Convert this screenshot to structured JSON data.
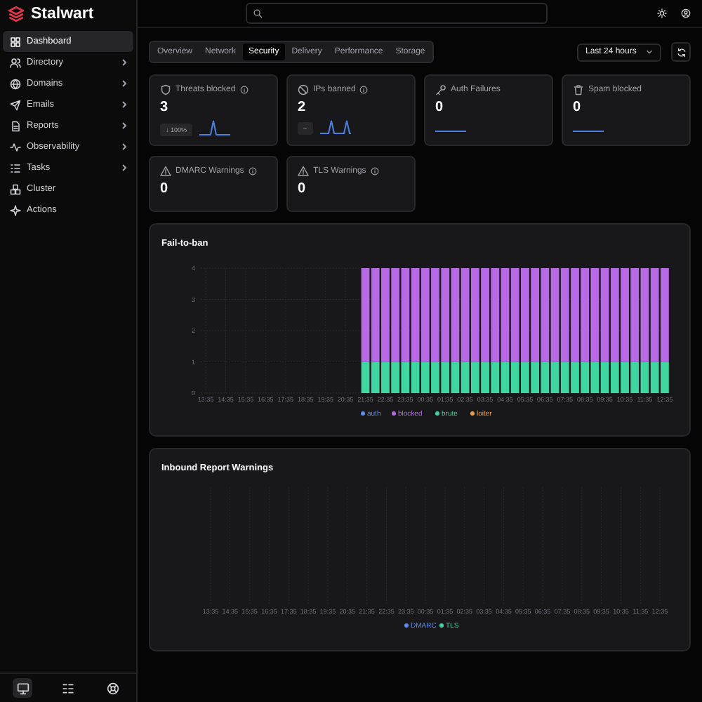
{
  "header": {
    "logo": "Stalwart"
  },
  "sidebar": {
    "items": [
      {
        "label": "Dashboard",
        "selected": true,
        "expandable": false
      },
      {
        "label": "Directory",
        "selected": false,
        "expandable": true
      },
      {
        "label": "Domains",
        "selected": false,
        "expandable": true
      },
      {
        "label": "Emails",
        "selected": false,
        "expandable": true
      },
      {
        "label": "Reports",
        "selected": false,
        "expandable": true
      },
      {
        "label": "Observability",
        "selected": false,
        "expandable": true
      },
      {
        "label": "Tasks",
        "selected": false,
        "expandable": true
      },
      {
        "label": "Cluster",
        "selected": false,
        "expandable": false
      },
      {
        "label": "Actions",
        "selected": false,
        "expandable": false
      }
    ],
    "footer_buttons": [
      {
        "selected": true
      },
      {
        "selected": false
      },
      {
        "selected": false
      }
    ]
  },
  "tabs": [
    {
      "label": "Overview",
      "selected": false
    },
    {
      "label": "Network",
      "selected": false
    },
    {
      "label": "Security",
      "selected": true
    },
    {
      "label": "Delivery",
      "selected": false
    },
    {
      "label": "Performance",
      "selected": false
    },
    {
      "label": "Storage",
      "selected": false
    }
  ],
  "time_range": {
    "value": "Last 24 hours"
  },
  "stats": [
    {
      "kind": "spike",
      "title": "Threats blocked",
      "info": true,
      "value": "3",
      "badge": "↓ 100%"
    },
    {
      "kind": "double-spike",
      "title": "IPs banned",
      "info": true,
      "value": "2",
      "badge": "–"
    },
    {
      "kind": "flat",
      "title": "Auth Failures",
      "info": false,
      "value": "0"
    },
    {
      "kind": "flat",
      "title": "Spam blocked",
      "info": false,
      "value": "0"
    },
    {
      "kind": "plain",
      "title": "DMARC Warnings",
      "info": true,
      "value": "0"
    },
    {
      "kind": "plain",
      "title": "TLS Warnings",
      "info": true,
      "value": "0"
    }
  ],
  "charts": [
    {
      "title": "Fail-to-ban",
      "chart_data": {
        "type": "bar",
        "stacked": true,
        "grid": true,
        "legend": true,
        "categories": [
          "13:35",
          null,
          "14:35",
          null,
          "15:35",
          null,
          "16:35",
          null,
          "17:35",
          null,
          "18:35",
          null,
          "19:35",
          null,
          "20:35",
          null,
          "21:35",
          null,
          "22:35",
          null,
          "23:35",
          null,
          "00:35",
          null,
          "01:35",
          null,
          "02:35",
          null,
          "03:35",
          null,
          "04:35",
          null,
          "05:35",
          null,
          "06:35",
          null,
          "07:35",
          null,
          "08:35",
          null,
          "09:35",
          null,
          "10:35",
          null,
          "11:35",
          null,
          "12:35"
        ],
        "ylim": [
          0,
          4
        ],
        "yticks": [
          0,
          1,
          2,
          3,
          4
        ],
        "series": [
          {
            "name": "auth",
            "color": "#5b8def",
            "values": [
              null,
              null,
              null,
              null,
              null,
              null,
              null,
              null,
              null,
              null,
              null,
              null,
              null,
              null,
              null,
              null,
              null,
              null,
              null,
              null,
              null,
              null,
              null,
              null,
              null,
              null,
              null,
              null,
              null,
              null,
              null,
              null,
              null,
              null,
              null,
              null,
              null,
              null,
              null,
              null,
              null,
              null,
              null,
              null,
              null,
              null,
              null
            ]
          },
          {
            "name": "blocked",
            "color": "#b86ae6",
            "values": [
              null,
              null,
              null,
              null,
              null,
              null,
              null,
              null,
              null,
              null,
              null,
              null,
              null,
              null,
              null,
              null,
              3,
              3,
              3,
              3,
              3,
              3,
              3,
              3,
              3,
              3,
              3,
              3,
              3,
              3,
              3,
              3,
              3,
              3,
              3,
              3,
              3,
              3,
              3,
              3,
              3,
              3,
              3,
              3,
              3,
              3,
              3
            ]
          },
          {
            "name": "brute",
            "color": "#3fd6a0",
            "values": [
              null,
              null,
              null,
              null,
              null,
              null,
              null,
              null,
              null,
              null,
              null,
              null,
              null,
              null,
              null,
              null,
              1,
              1,
              1,
              1,
              1,
              1,
              1,
              1,
              1,
              1,
              1,
              1,
              1,
              1,
              1,
              1,
              1,
              1,
              1,
              1,
              1,
              1,
              1,
              1,
              1,
              1,
              1,
              1,
              1,
              1,
              1
            ]
          },
          {
            "name": "loiter",
            "color": "#f0a04b",
            "values": [
              null,
              null,
              null,
              null,
              null,
              null,
              null,
              null,
              null,
              null,
              null,
              null,
              null,
              null,
              null,
              null,
              null,
              null,
              null,
              null,
              null,
              null,
              null,
              null,
              null,
              null,
              null,
              null,
              null,
              null,
              null,
              null,
              null,
              null,
              null,
              null,
              null,
              null,
              null,
              null,
              null,
              null,
              null,
              null,
              null,
              null,
              null
            ]
          }
        ]
      }
    },
    {
      "title": "Inbound Report Warnings",
      "x_labels": [
        "13:35",
        "14:35",
        "15:35",
        "16:35",
        "17:35",
        "18:35",
        "19:35",
        "20:35",
        "21:35",
        "22:35",
        "23:35",
        "00:35",
        "01:35",
        "02:35",
        "03:35",
        "04:35",
        "05:35",
        "06:35",
        "07:35",
        "08:35",
        "09:35",
        "10:35",
        "11:35",
        "12:35"
      ],
      "legend": [
        {
          "name": "DMARC",
          "color": "#5b8def"
        },
        {
          "name": "TLS",
          "color": "#3fd6a0"
        }
      ]
    }
  ]
}
